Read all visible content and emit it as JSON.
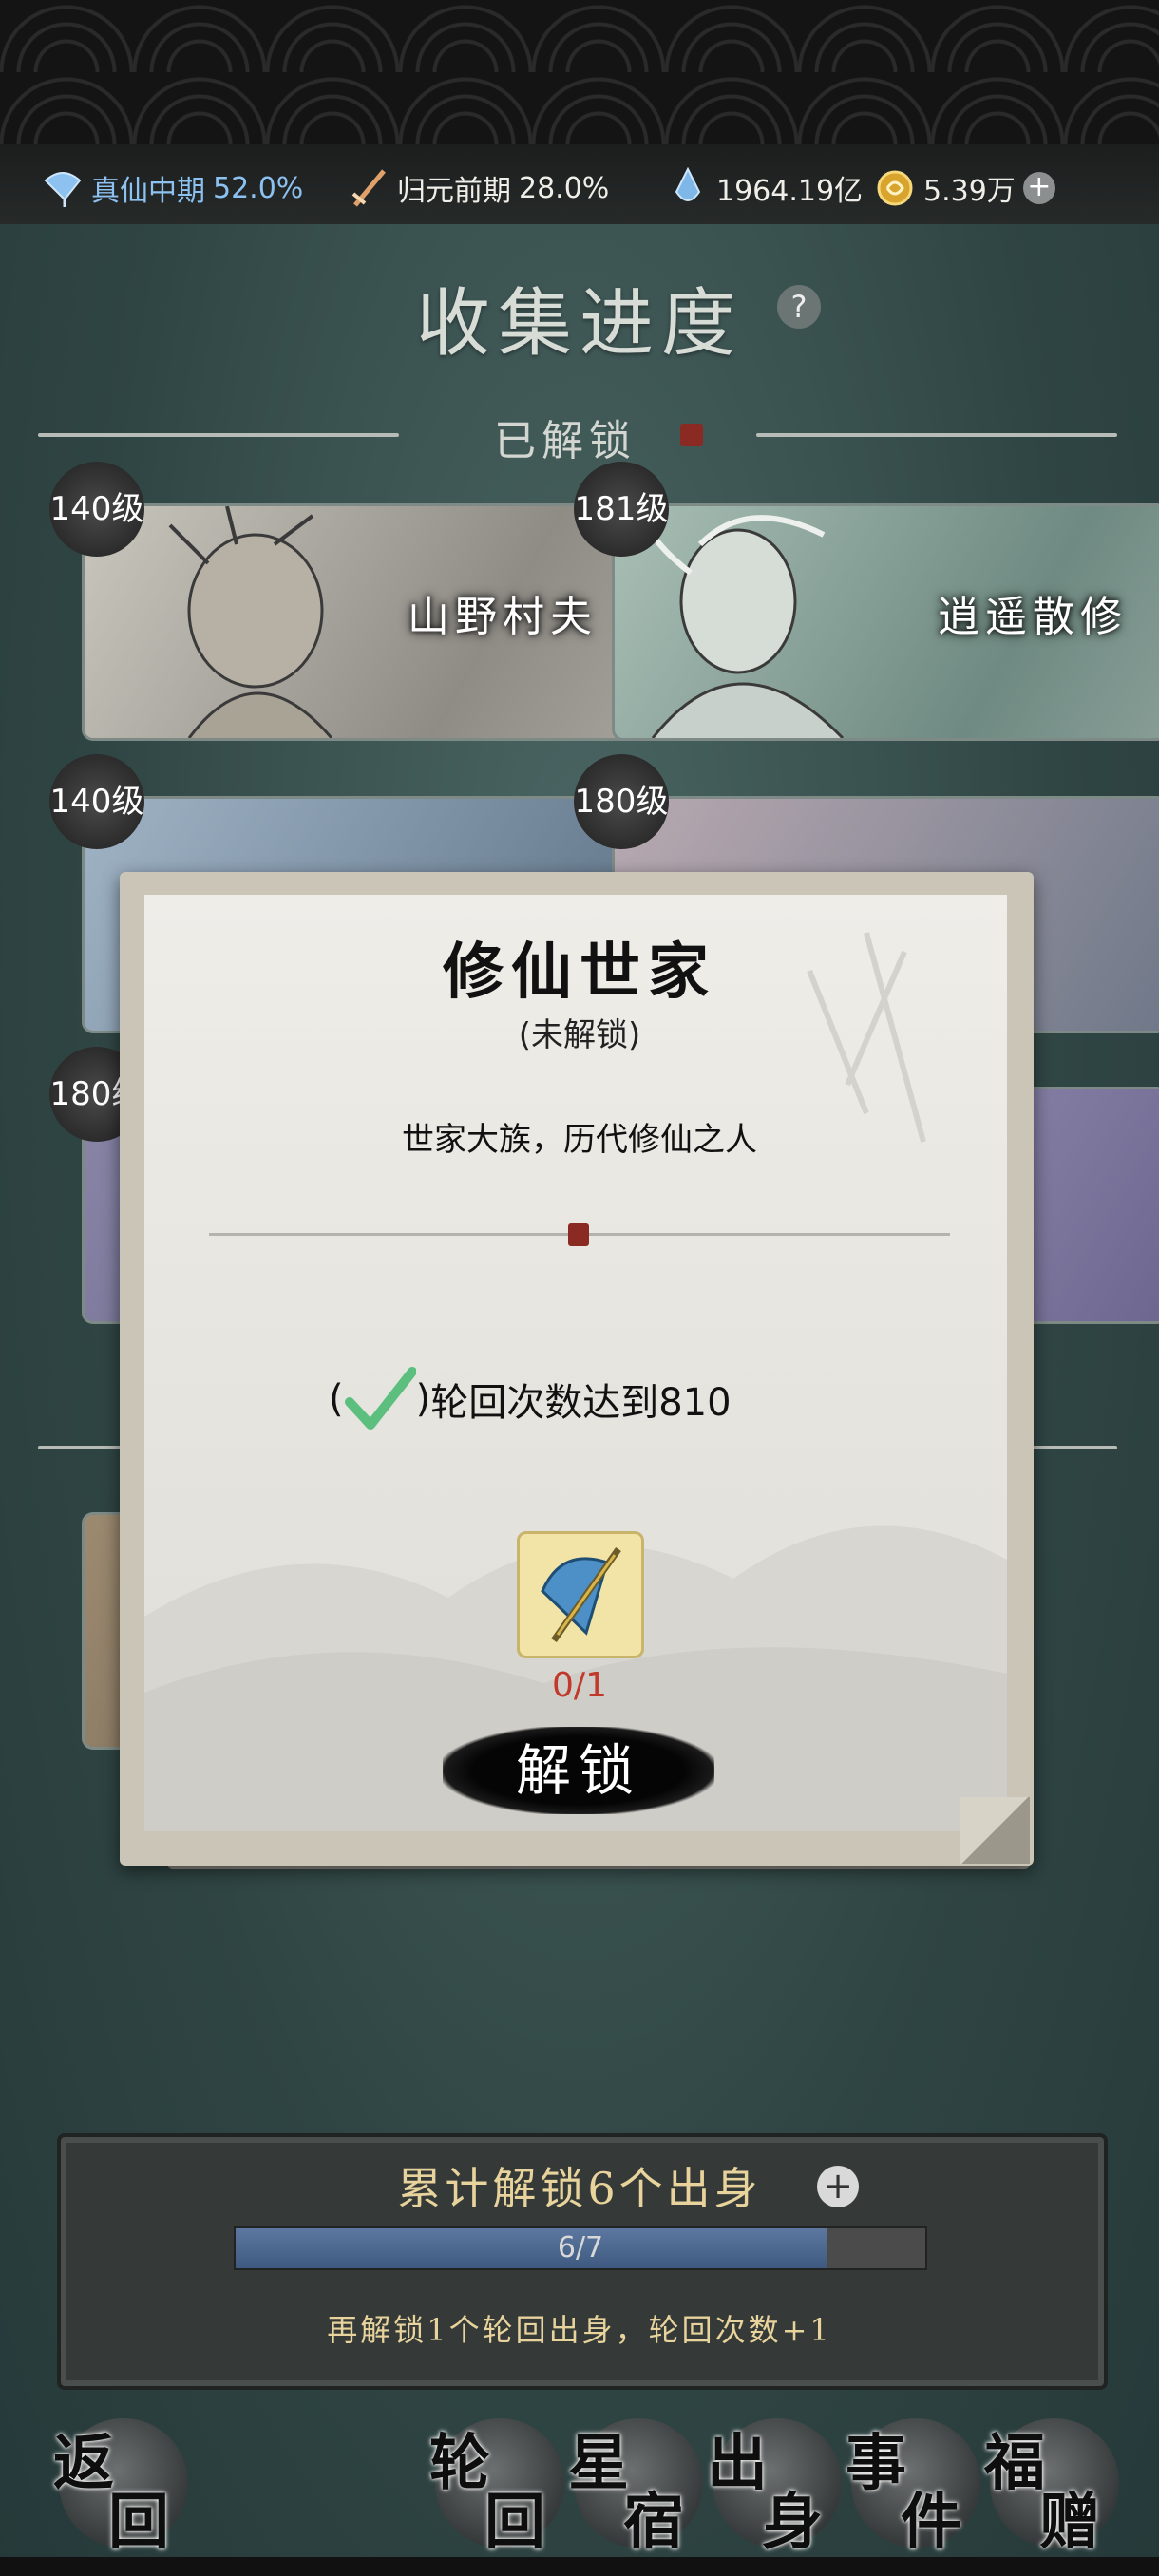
{
  "resources": {
    "realm1": {
      "label": "真仙中期",
      "pct": "52.0%"
    },
    "realm2": {
      "label": "归元前期",
      "pct": "28.0%"
    },
    "spirit_stones": "1964.19亿",
    "coins": "5.39万",
    "add_symbol": "+"
  },
  "page": {
    "title": "收集进度",
    "help_symbol": "?",
    "unlocked_section": "已解锁"
  },
  "cards": [
    {
      "level": "140级",
      "name": "山野村夫"
    },
    {
      "level": "181级",
      "name": "逍遥散修"
    },
    {
      "level": "140级",
      "name": ""
    },
    {
      "level": "180级",
      "name": ""
    },
    {
      "level": "180级",
      "name": ""
    }
  ],
  "modal": {
    "title": "修仙世家",
    "status": "(未解锁)",
    "description": "世家大族，历代修仙之人",
    "condition_open": "(",
    "condition_close": ")",
    "condition_text": "轮回次数达到810",
    "item_count": "0/1",
    "unlock_button": "解锁"
  },
  "progress_panel": {
    "title": "累计解锁6个出身",
    "plus_symbol": "+",
    "progress_label": "6/7",
    "progress_fraction": 0.857,
    "hint": "再解锁1个轮回出身，轮回次数+1"
  },
  "nav": {
    "back": [
      "返",
      "回"
    ],
    "items": [
      [
        "轮",
        "回"
      ],
      [
        "星",
        "宿"
      ],
      [
        "出",
        "身"
      ],
      [
        "事",
        "件"
      ],
      [
        "福",
        "赠"
      ]
    ]
  },
  "colors": {
    "accent_gold": "#e7d39b",
    "accent_blue": "#8cc1f0",
    "count_red": "#c0392b",
    "check_green": "#5cbf7e"
  }
}
